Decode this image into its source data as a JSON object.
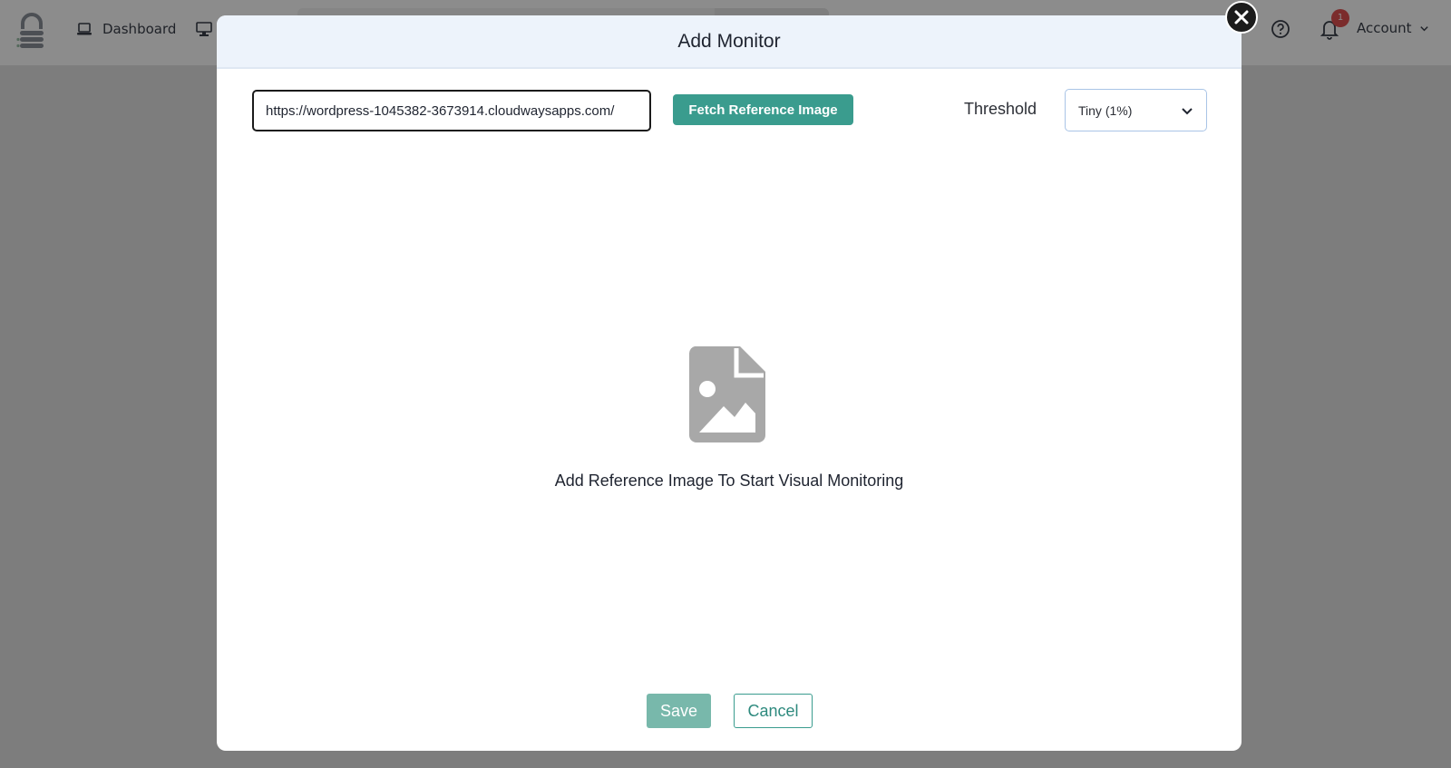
{
  "nav": {
    "dashboard_label": "Dashboard",
    "account_label": "Account",
    "notification_count": "1"
  },
  "modal": {
    "title": "Add Monitor",
    "url_value": "https://wordpress-1045382-3673914.cloudwaysapps.com/",
    "fetch_button_label": "Fetch Reference Image",
    "threshold_label": "Threshold",
    "threshold_selected": "Tiny (1%)",
    "placeholder_message": "Add Reference Image To Start Visual Monitoring",
    "save_label": "Save",
    "cancel_label": "Cancel"
  },
  "colors": {
    "accent": "#3a9c8e",
    "save_disabled": "#78b8ab",
    "header_bg": "#edf3fb",
    "overlay": "rgba(0,0,0,0.45)"
  },
  "icons": {
    "logo": "lock-stack-logo",
    "dashboard": "laptop-icon",
    "monitor": "monitor-icon",
    "help": "help-circle-icon",
    "bell": "bell-icon",
    "close": "close-icon",
    "chevron": "chevron-down-icon",
    "placeholder": "image-file-icon"
  }
}
